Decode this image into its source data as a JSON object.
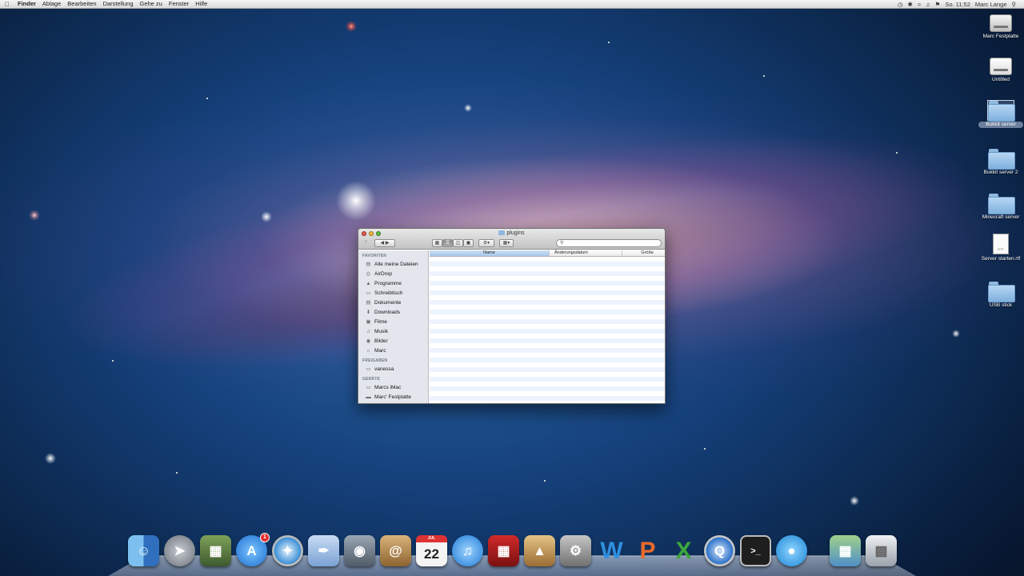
{
  "menubar": {
    "app_name": "Finder",
    "items": [
      "Ablage",
      "Bearbeiten",
      "Darstellung",
      "Gehe zu",
      "Fenster",
      "Hilfe"
    ],
    "clock": "So. 11:52",
    "user": "Marc Lange"
  },
  "desktop_icons": [
    {
      "label": "Marc Festplatte",
      "kind": "hard-disk-icon"
    },
    {
      "label": "Untitled",
      "kind": "disk-icon"
    },
    {
      "label": "Bukkit server",
      "kind": "folder-icon",
      "selected": true
    },
    {
      "label": "Bukkit server 2",
      "kind": "folder-icon"
    },
    {
      "label": "Minecraft server",
      "kind": "folder-icon"
    },
    {
      "label": "Server starten.rtf",
      "kind": "document-icon"
    },
    {
      "label": "USB stick",
      "kind": "folder-icon"
    }
  ],
  "finder": {
    "title": "plugins",
    "search_placeholder": "",
    "sidebar": {
      "favorites_header": "FAVORITEN",
      "favorites": [
        {
          "label": "Alle meine Dateien",
          "icon": "all-files-icon"
        },
        {
          "label": "AirDrop",
          "icon": "airdrop-icon"
        },
        {
          "label": "Programme",
          "icon": "applications-icon"
        },
        {
          "label": "Schreibtisch",
          "icon": "desktop-icon"
        },
        {
          "label": "Dokumente",
          "icon": "documents-icon"
        },
        {
          "label": "Downloads",
          "icon": "downloads-icon"
        },
        {
          "label": "Filme",
          "icon": "movies-icon"
        },
        {
          "label": "Musik",
          "icon": "music-icon"
        },
        {
          "label": "Bilder",
          "icon": "pictures-icon"
        },
        {
          "label": "Marc",
          "icon": "home-icon"
        }
      ],
      "shared_header": "FREIGABEN",
      "shared": [
        {
          "label": "vanessa",
          "icon": "network-computer-icon"
        }
      ],
      "devices_header": "GERÄTE",
      "devices": [
        {
          "label": "Marcs iMac",
          "icon": "imac-icon"
        },
        {
          "label": "Marc' Festplatte",
          "icon": "hard-disk-icon"
        }
      ]
    },
    "columns": {
      "name": "Name",
      "date": "Änderungsdatum",
      "size": "Größe"
    }
  },
  "dock": {
    "items": [
      {
        "name": "finder",
        "color": "#4a8fd8"
      },
      {
        "name": "launchpad",
        "color": "#8a8f98"
      },
      {
        "name": "mission-control",
        "color": "#5f7a4c"
      },
      {
        "name": "app-store",
        "color": "#2e86e0",
        "badge": "1"
      },
      {
        "name": "safari",
        "color": "#3c8fd6"
      },
      {
        "name": "mail",
        "color": "#7aa2d4"
      },
      {
        "name": "facetime",
        "color": "#6f7d8c"
      },
      {
        "name": "address-book",
        "color": "#b58a4e"
      },
      {
        "name": "ical",
        "color": "#f4f4f4",
        "day": "22",
        "month": "JUL"
      },
      {
        "name": "itunes",
        "color": "#1c7ad6"
      },
      {
        "name": "photo-booth",
        "color": "#b21f1f"
      },
      {
        "name": "iphoto",
        "color": "#c99a55"
      },
      {
        "name": "system-preferences",
        "color": "#8c8c8c"
      },
      {
        "name": "microsoft-word",
        "color": "#2f8fde",
        "letter": "W"
      },
      {
        "name": "microsoft-powerpoint",
        "color": "#e86a2a",
        "letter": "P"
      },
      {
        "name": "microsoft-excel",
        "color": "#3ca63a",
        "letter": "X"
      },
      {
        "name": "quicktime",
        "color": "#2d72c8"
      },
      {
        "name": "terminal",
        "color": "#1e1e1e",
        "letter": ">_"
      },
      {
        "name": "network-app",
        "color": "#2a9ce6"
      },
      {
        "name": "preview-stack",
        "color": "#6fa7c8"
      },
      {
        "name": "trash",
        "color": "#c7ccd3"
      }
    ]
  }
}
